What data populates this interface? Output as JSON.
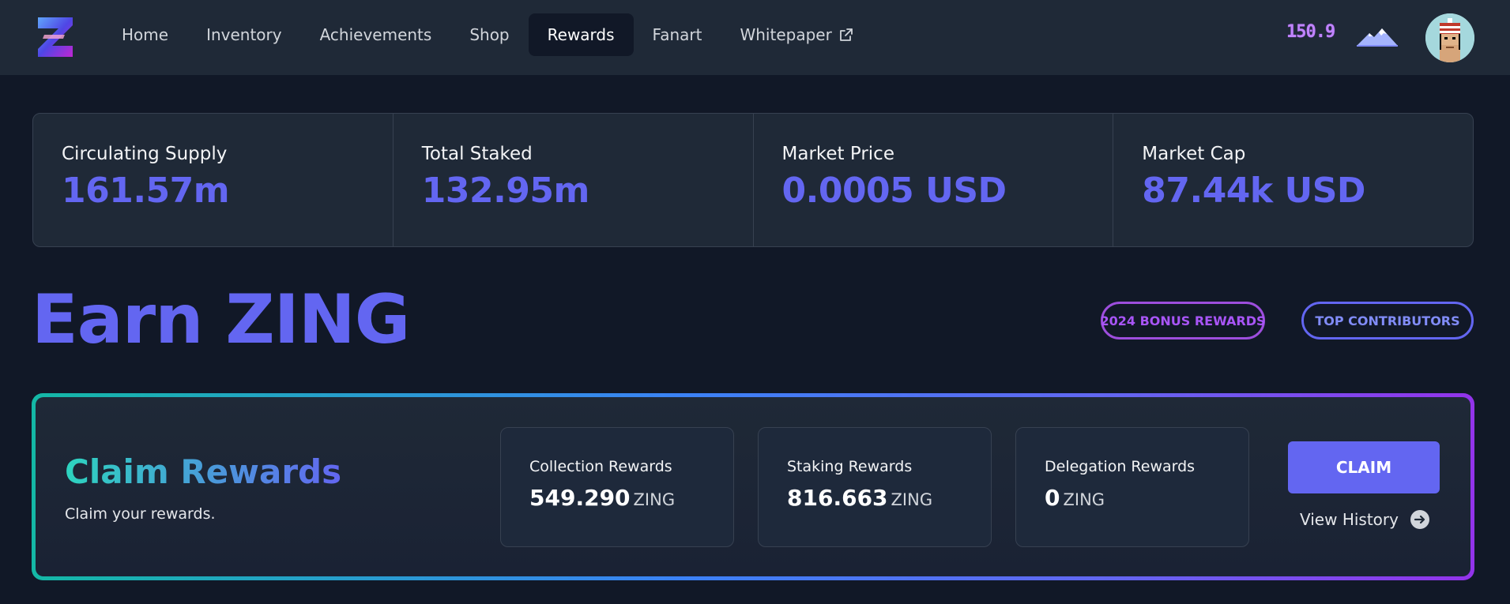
{
  "nav": {
    "logo_icon": "z-logo-icon",
    "links": [
      {
        "label": "Home",
        "active": false
      },
      {
        "label": "Inventory",
        "active": false
      },
      {
        "label": "Achievements",
        "active": false
      },
      {
        "label": "Shop",
        "active": false
      },
      {
        "label": "Rewards",
        "active": true
      },
      {
        "label": "Fanart",
        "active": false
      },
      {
        "label": "Whitepaper",
        "active": false,
        "external": true
      }
    ],
    "balance": "150.9",
    "balance_icon": "mountain-icon",
    "avatar_icon": "pixel-avatar-icon"
  },
  "stats": [
    {
      "label": "Circulating Supply",
      "value": "161.57m"
    },
    {
      "label": "Total Staked",
      "value": "132.95m"
    },
    {
      "label": "Market Price",
      "value": "0.0005 USD"
    },
    {
      "label": "Market Cap",
      "value": "87.44k USD"
    }
  ],
  "page": {
    "title": "Earn ZING",
    "bonus_button": "2024 BONUS REWARDS",
    "contributors_button": "TOP CONTRIBUTORS"
  },
  "claim": {
    "title": "Claim Rewards",
    "subtitle": "Claim your rewards.",
    "cards": [
      {
        "label": "Collection Rewards",
        "value": "549.290",
        "unit": "ZING"
      },
      {
        "label": "Staking Rewards",
        "value": "816.663",
        "unit": "ZING"
      },
      {
        "label": "Delegation Rewards",
        "value": "0",
        "unit": "ZING"
      }
    ],
    "button": "CLAIM",
    "history": "View History"
  },
  "colors": {
    "accent": "#6366f1",
    "background": "#111827",
    "panel": "#1f2937",
    "purple": "#a855f7",
    "teal": "#14b8a6"
  }
}
